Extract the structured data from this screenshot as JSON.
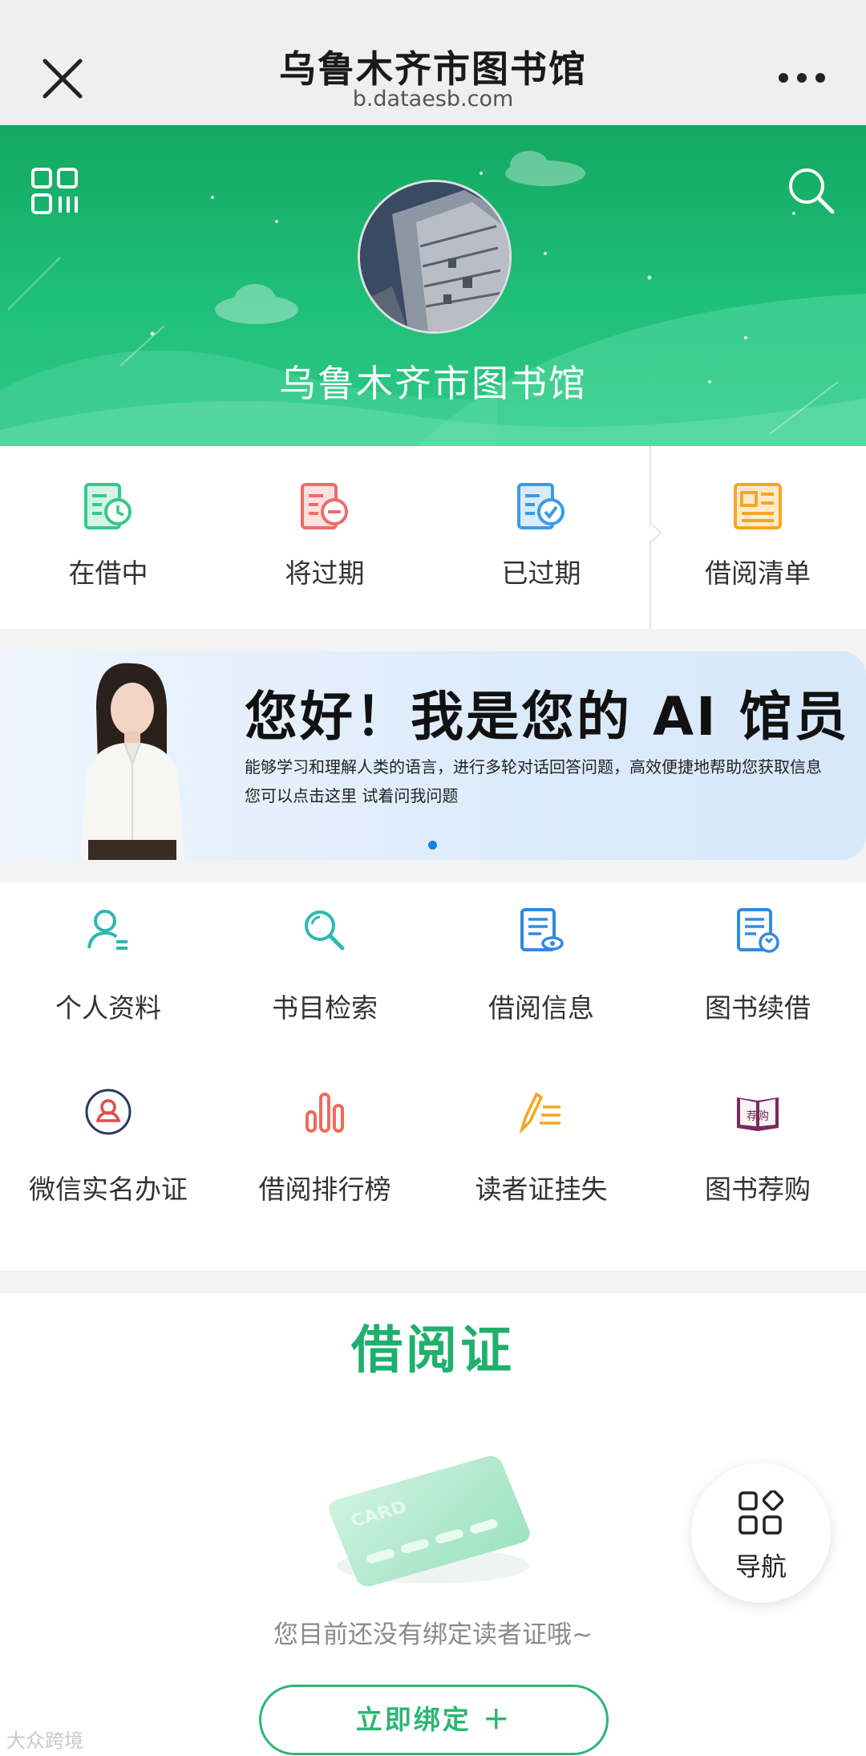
{
  "header": {
    "title": "乌鲁木齐市图书馆",
    "url": "b.dataesb.com"
  },
  "hero": {
    "library_name": "乌鲁木齐市图书馆"
  },
  "quick_links": [
    {
      "label": "在借中",
      "color": "#34c98a"
    },
    {
      "label": "将过期",
      "color": "#f06a6a"
    },
    {
      "label": "已过期",
      "color": "#3a9be8"
    },
    {
      "label": "借阅清单",
      "color": "#f5a623"
    }
  ],
  "banner": {
    "headline": "您好！我是您的 AI 馆员",
    "desc_line1": "能够学习和理解人类的语言，进行多轮对话回答问题，高效便捷地帮助您获取信息",
    "desc_line2": "您可以点击这里 试着问我问题"
  },
  "services": [
    {
      "label": "个人资料",
      "icon": "user-profile-icon",
      "color": "#2bb9b1"
    },
    {
      "label": "书目检索",
      "icon": "search-catalog-icon",
      "color": "#2bb9b1"
    },
    {
      "label": "借阅信息",
      "icon": "borrow-info-icon",
      "color": "#2f8be0"
    },
    {
      "label": "图书续借",
      "icon": "renew-icon",
      "color": "#2f8be0"
    },
    {
      "label": "微信实名办证",
      "icon": "wechat-id-icon",
      "color": "#e34b4b"
    },
    {
      "label": "借阅排行榜",
      "icon": "ranking-icon",
      "color": "#f06a5a"
    },
    {
      "label": "读者证挂失",
      "icon": "report-loss-icon",
      "color": "#f5a623"
    },
    {
      "label": "图书荐购",
      "icon": "recommend-book-icon",
      "color": "#7a2a5a",
      "badge": "荐购"
    }
  ],
  "pager": {
    "active_color": "#1aa064",
    "inactive_color": "#c8c8c8"
  },
  "reader_card": {
    "title": "借阅证",
    "card_text": "CARD",
    "empty_text": "您目前还没有绑定读者证哦~",
    "bind_button": "立即绑定 ＋"
  },
  "fab": {
    "label": "导航"
  },
  "watermark": "大众跨境"
}
